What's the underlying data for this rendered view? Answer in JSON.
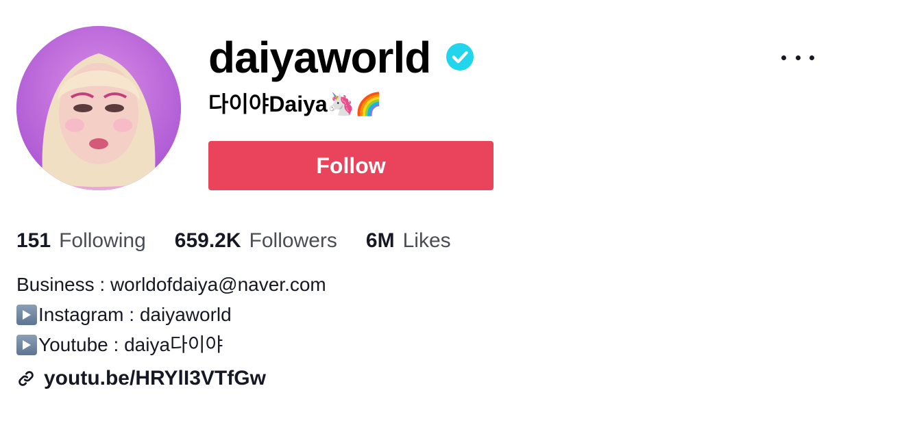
{
  "profile": {
    "username": "daiyaworld",
    "nickname": "다이야Daiya🦄🌈",
    "follow_label": "Follow",
    "verified": true
  },
  "stats": {
    "following_count": "151",
    "following_label": "Following",
    "followers_count": "659.2K",
    "followers_label": "Followers",
    "likes_count": "6M",
    "likes_label": "Likes"
  },
  "bio": {
    "line1": "Business : worldofdaiya@naver.com",
    "line2": "Instagram : daiyaworld",
    "line3": "Youtube : daiya다이야"
  },
  "link": {
    "text": "youtu.be/HRYlI3VTfGw"
  },
  "icons": {
    "verified": "verified-badge-icon",
    "more": "more-options-icon",
    "play": "play-button-icon",
    "link": "link-icon"
  },
  "colors": {
    "follow_button": "#ea435c",
    "verified_badge": "#20d5ec",
    "text_primary": "#161823",
    "text_secondary": "#4b4d55"
  }
}
